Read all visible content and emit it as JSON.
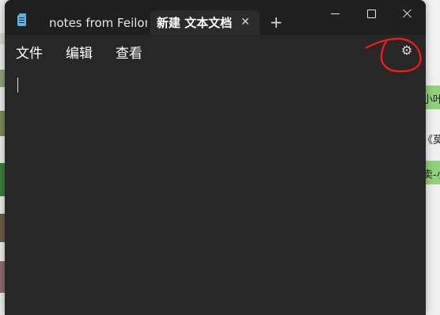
{
  "app": {
    "icon": "notepad-icon",
    "tabs": [
      {
        "label": "notes from Feilon",
        "active": false
      },
      {
        "label": "新建 文本文档",
        "active": true,
        "close_icon": "close-icon"
      }
    ],
    "new_tab_icon": "plus-icon"
  },
  "window_controls": {
    "minimize_icon": "minimize-icon",
    "maximize_icon": "maximize-icon",
    "close_icon": "close-icon"
  },
  "menu": {
    "items": [
      "文件",
      "编辑",
      "查看"
    ],
    "settings_icon": "gear-icon"
  },
  "editor": {
    "content": ""
  },
  "background_peek": {
    "texts": [
      "小叶",
      "《莫",
      "卖-小"
    ]
  },
  "colors": {
    "annotation": "#ff1a1a",
    "tab_icon": "#58b7e8",
    "titlebar": "#1f1f1f",
    "editor": "#272727"
  }
}
